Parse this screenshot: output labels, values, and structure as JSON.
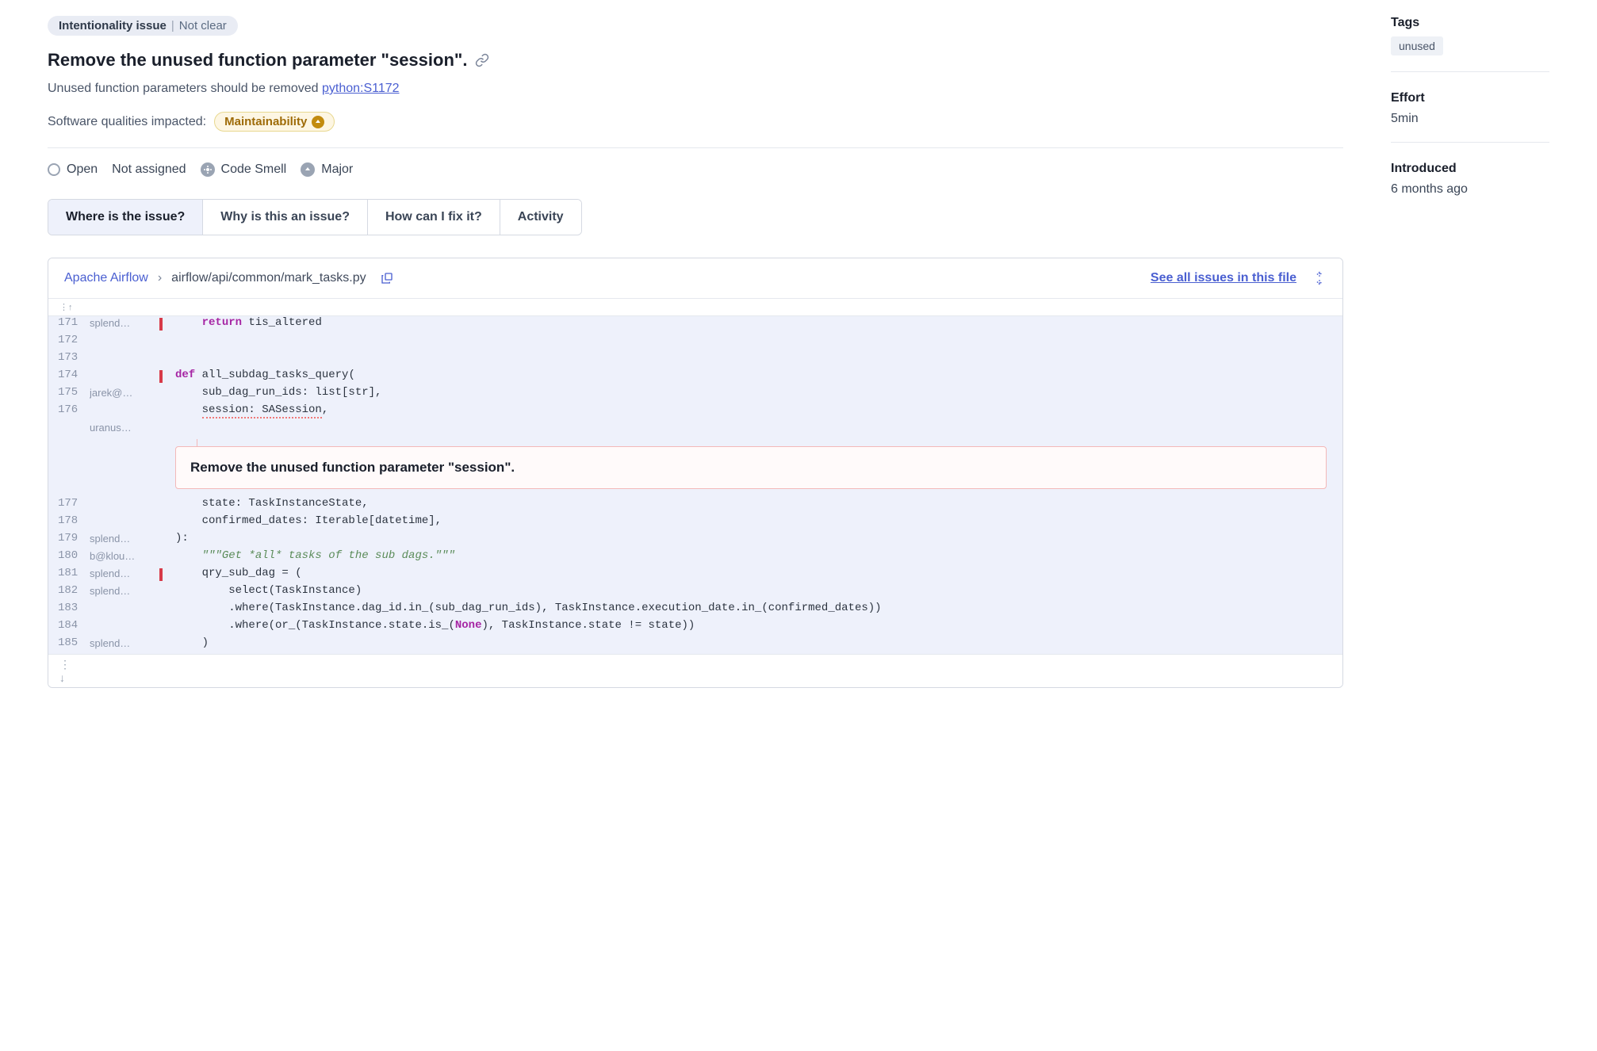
{
  "issueType": {
    "label": "Intentionality issue",
    "detail": "Not clear"
  },
  "title": "Remove the unused function parameter \"session\".",
  "ruleDescription": "Unused function parameters should be removed",
  "ruleKey": "python:S1172",
  "qualitiesLabel": "Software qualities impacted:",
  "qualities": [
    "Maintainability"
  ],
  "status": {
    "open": "Open",
    "assignee": "Not assigned",
    "type": "Code Smell",
    "severity": "Major"
  },
  "tabs": [
    "Where is the issue?",
    "Why is this an issue?",
    "How can I fix it?",
    "Activity"
  ],
  "activeTab": 0,
  "breadcrumb": {
    "project": "Apache Airflow",
    "path": "airflow/api/common/mark_tasks.py"
  },
  "seeAll": "See all issues in this file",
  "sidebar": {
    "tagsLabel": "Tags",
    "tags": [
      "unused"
    ],
    "effortLabel": "Effort",
    "effort": "5min",
    "introLabel": "Introduced",
    "intro": "6 months ago"
  },
  "calloutText": "Remove the unused function parameter \"session\".",
  "code": [
    {
      "n": "171",
      "author": "splend…",
      "marker": true,
      "html": "    <span class='kw'>return</span> tis_altered"
    },
    {
      "n": "172",
      "author": "",
      "html": ""
    },
    {
      "n": "173",
      "author": "",
      "html": ""
    },
    {
      "n": "174",
      "author": "",
      "marker": true,
      "html": "<span class='kw'>def</span> all_subdag_tasks_query("
    },
    {
      "n": "175",
      "author": "jarek@…",
      "html": "    sub_dag_run_ids: list[str],"
    },
    {
      "n": "176",
      "author": "",
      "html": "    <span class='squiggle'>session: SASession</span>,"
    },
    {
      "callout": true,
      "author": "uranus…"
    },
    {
      "n": "177",
      "author": "",
      "html": "    state: TaskInstanceState,"
    },
    {
      "n": "178",
      "author": "",
      "html": "    confirmed_dates: Iterable[datetime],"
    },
    {
      "n": "179",
      "author": "splend…",
      "html": "):"
    },
    {
      "n": "180",
      "author": "b@klou…",
      "html": "    <span class='cmt'>\"\"\"Get *all* tasks of the sub dags.\"\"\"</span>"
    },
    {
      "n": "181",
      "author": "splend…",
      "marker": true,
      "html": "    qry_sub_dag = ("
    },
    {
      "n": "182",
      "author": "splend…",
      "html": "        select(TaskInstance)"
    },
    {
      "n": "183",
      "author": "",
      "html": "        .where(TaskInstance.dag_id.in_(sub_dag_run_ids), TaskInstance.execution_date.in_(confirmed_dates))"
    },
    {
      "n": "184",
      "author": "",
      "html": "        .where(or_(TaskInstance.state.is_(<span class='const'>None</span>), TaskInstance.state != state))"
    },
    {
      "n": "185",
      "author": "splend…",
      "html": "    )"
    }
  ]
}
